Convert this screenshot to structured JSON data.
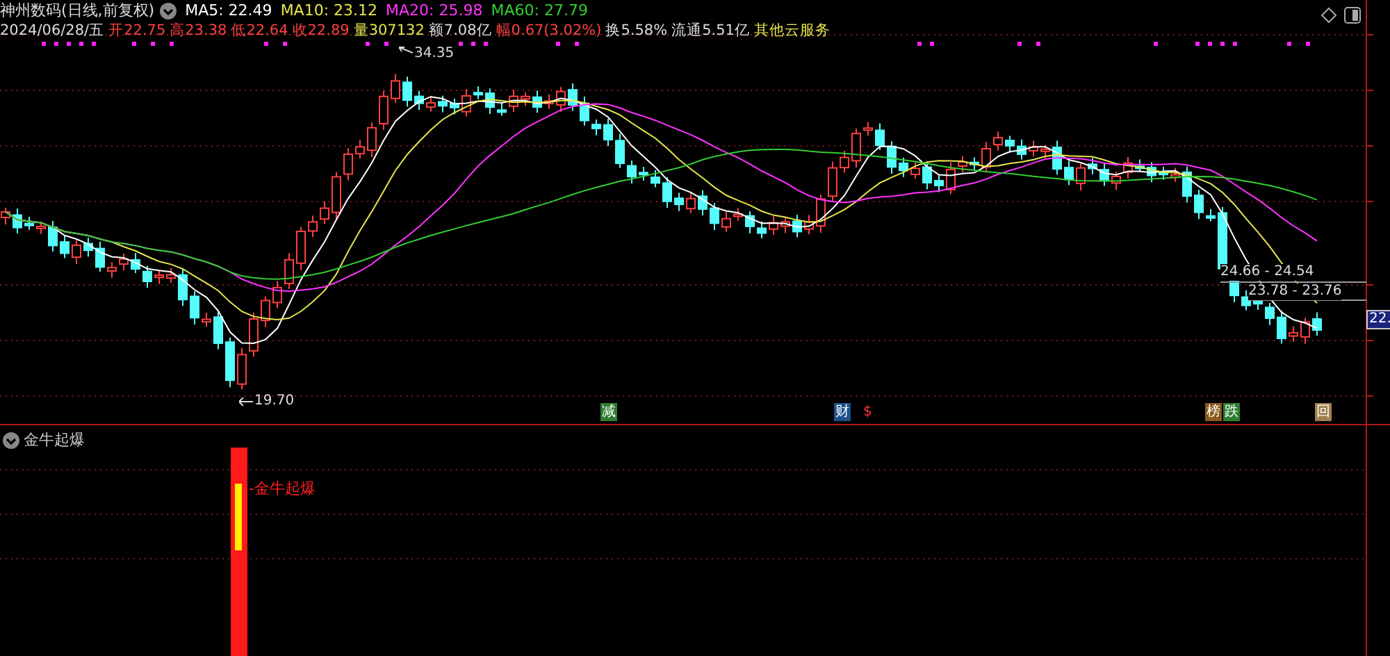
{
  "header": {
    "title": "神州数码(日线,前复权)",
    "indicators": [
      {
        "label": "MA5: 22.49",
        "color": "#ffffff"
      },
      {
        "label": "MA10: 23.12",
        "color": "#e6e64c"
      },
      {
        "label": "MA20: 25.98",
        "color": "#ff33ff"
      },
      {
        "label": "MA60: 27.79",
        "color": "#33cc33"
      }
    ]
  },
  "quote": [
    {
      "text": "2024/06/28/五",
      "color": "#dddddd"
    },
    {
      "text": "开22.75",
      "color": "#ff4040"
    },
    {
      "text": "高23.38",
      "color": "#ff4040"
    },
    {
      "text": "低22.64",
      "color": "#ff4040"
    },
    {
      "text": "收22.89",
      "color": "#ff4040"
    },
    {
      "text": "量307132",
      "color": "#e6e64c"
    },
    {
      "text": "额7.08亿",
      "color": "#dddddd"
    },
    {
      "text": "幅0.67(3.02%)",
      "color": "#ff4040"
    },
    {
      "text": "换5.58%",
      "color": "#dddddd"
    },
    {
      "text": "流通5.51亿",
      "color": "#dddddd"
    },
    {
      "text": "其他云服务",
      "color": "#e6e64c"
    }
  ],
  "annotations": {
    "high": "34.35",
    "low": "19.70",
    "ranges": [
      "24.66 - 24.54",
      "23.78 - 23.76"
    ],
    "price_tag": "22."
  },
  "events": [
    {
      "text": "减",
      "color": "#2e7d32"
    },
    {
      "text": "财",
      "color": "#1e4f8c"
    },
    {
      "text": "$",
      "color": "#000000"
    },
    {
      "text": "榜",
      "color": "#8a5a1c"
    },
    {
      "text": "跌",
      "color": "#2e7d32"
    },
    {
      "text": "回",
      "color": "#a08050"
    }
  ],
  "lower_pane": {
    "title": "金牛起爆",
    "signal_label": "-金牛起爆"
  }
}
